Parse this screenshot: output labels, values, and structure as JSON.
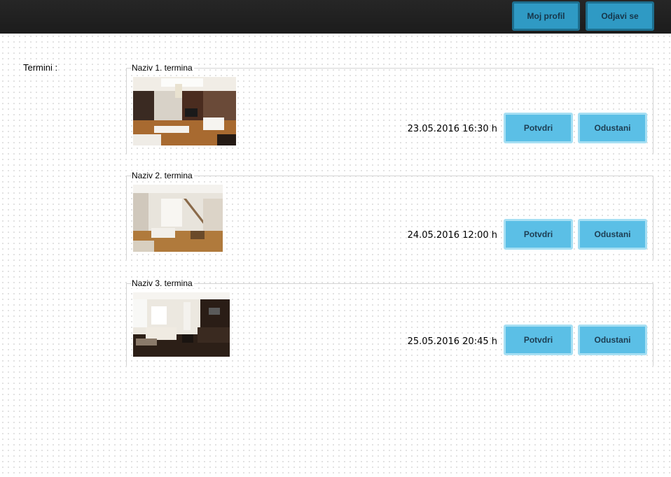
{
  "header": {
    "profile_label": "Moj profil",
    "logout_label": "Odjavi se"
  },
  "section_label": "Termini :",
  "appointments": [
    {
      "name": "Naziv 1. termina",
      "datetime": "23.05.2016 16:30 h",
      "confirm_label": "Potvdri",
      "cancel_label": "Odustani"
    },
    {
      "name": "Naziv 2. termina",
      "datetime": "24.05.2016 12:00 h",
      "confirm_label": "Potvdri",
      "cancel_label": "Odustani"
    },
    {
      "name": "Naziv 3. termina",
      "datetime": "25.05.2016 20:45 h",
      "confirm_label": "Potvdri",
      "cancel_label": "Odustani"
    }
  ],
  "colors": {
    "topbar": "#1f1f1f",
    "header_button": "#2f9ac4",
    "action_button": "#5bbfe6"
  }
}
